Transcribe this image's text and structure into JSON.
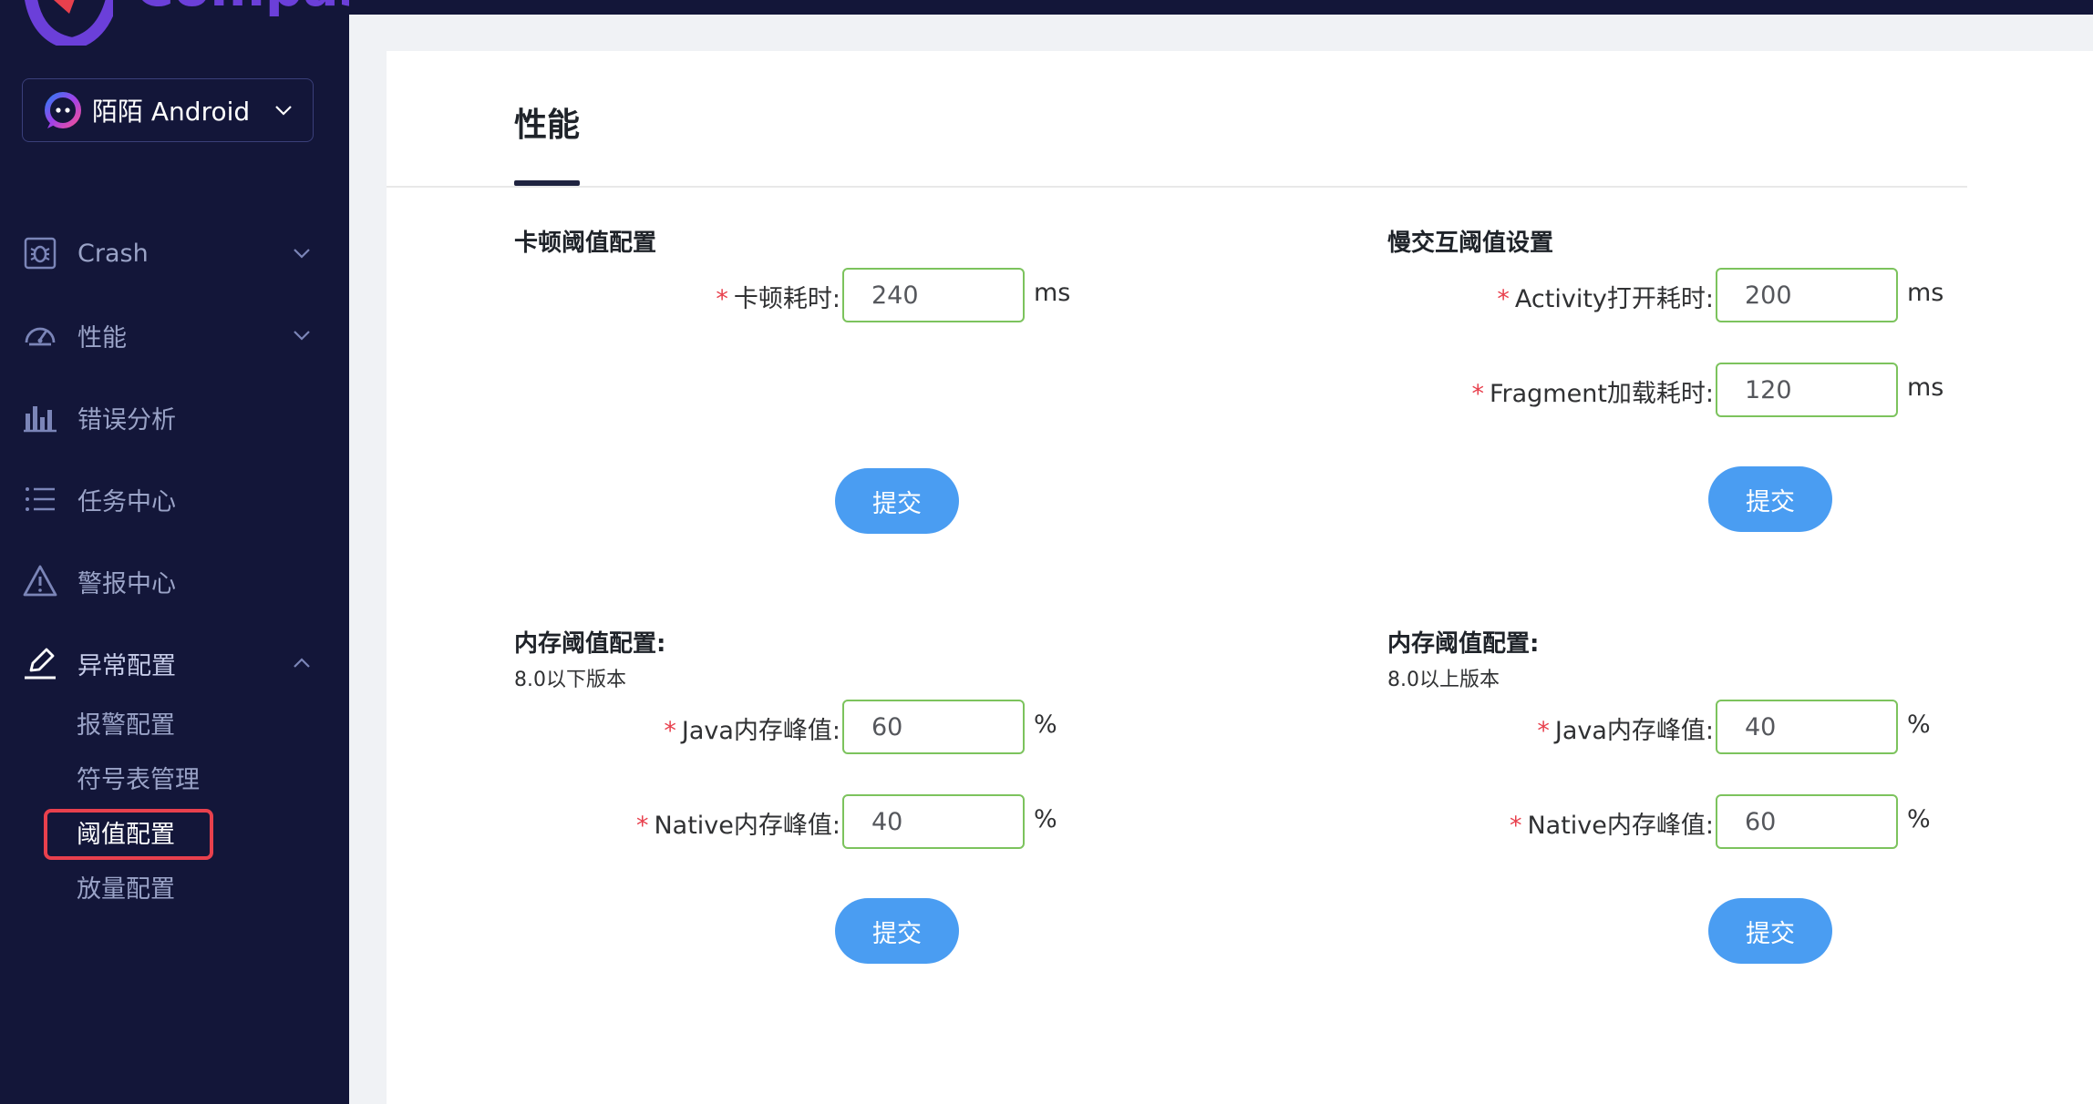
{
  "brand": {
    "name": "Compass"
  },
  "app_selector": {
    "name": "陌陌 Android"
  },
  "sidebar": {
    "items": [
      {
        "label": "Crash",
        "icon": "bug-icon"
      },
      {
        "label": "性能",
        "icon": "speedometer-icon"
      },
      {
        "label": "错误分析",
        "icon": "bar-chart-icon"
      },
      {
        "label": "任务中心",
        "icon": "list-icon"
      },
      {
        "label": "警报中心",
        "icon": "warning-icon"
      },
      {
        "label": "异常配置",
        "icon": "pen-icon"
      }
    ],
    "submenu": [
      {
        "label": "报警配置"
      },
      {
        "label": "符号表管理"
      },
      {
        "label": "阈值配置",
        "active": true
      },
      {
        "label": "放量配置"
      }
    ]
  },
  "tab": {
    "title": "性能"
  },
  "sections": {
    "lag": {
      "title": "卡顿阈值配置",
      "fields": [
        {
          "label": "卡顿耗时:",
          "value": "240",
          "unit": "ms"
        }
      ],
      "submit": "提交"
    },
    "slow": {
      "title": "慢交互阈值设置",
      "fields": [
        {
          "label": "Activity打开耗时:",
          "value": "200",
          "unit": "ms"
        },
        {
          "label": "Fragment加载耗时:",
          "value": "120",
          "unit": "ms"
        }
      ],
      "submit": "提交"
    },
    "mem_below": {
      "title": "内存阈值配置:",
      "subtitle": "8.0以下版本",
      "fields": [
        {
          "label": "Java内存峰值:",
          "value": "60",
          "unit": "%"
        },
        {
          "label": "Native内存峰值:",
          "value": "40",
          "unit": "%"
        }
      ],
      "submit": "提交"
    },
    "mem_above": {
      "title": "内存阈值配置:",
      "subtitle": "8.0以上版本",
      "fields": [
        {
          "label": "Java内存峰值:",
          "value": "40",
          "unit": "%"
        },
        {
          "label": "Native内存峰值:",
          "value": "60",
          "unit": "%"
        }
      ],
      "submit": "提交"
    }
  },
  "colors": {
    "sidebar_bg": "#131639",
    "accent": "#4a9df2",
    "input_border": "#7cc35d",
    "highlight": "#e8404d"
  }
}
